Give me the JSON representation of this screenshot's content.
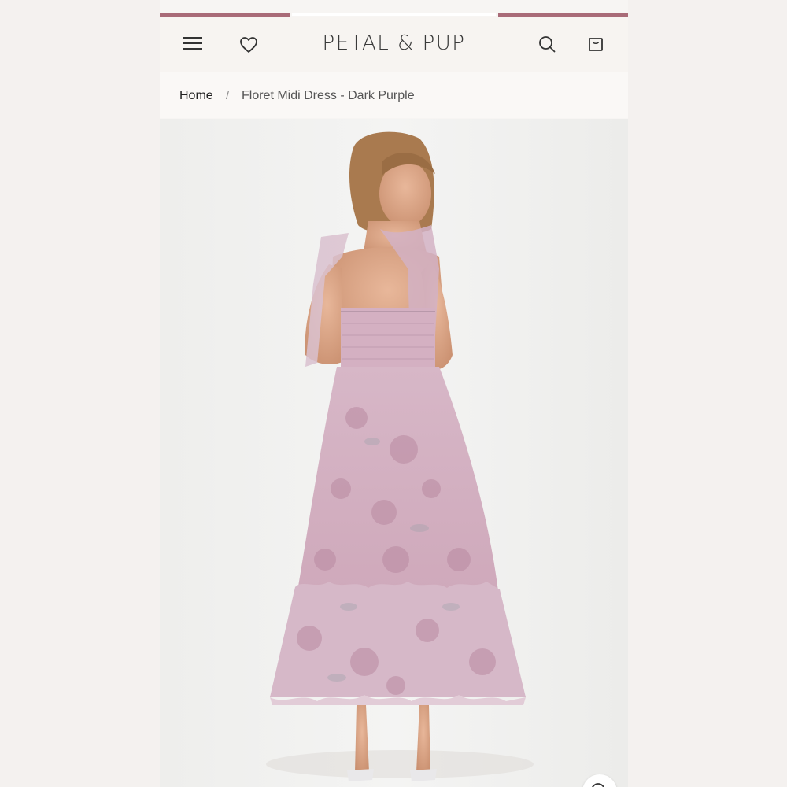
{
  "header": {
    "brand": "PETAL & PUP",
    "icons": {
      "menu": "hamburger-menu-icon",
      "wishlist": "heart-icon",
      "search": "search-icon",
      "cart": "shopping-bag-icon"
    }
  },
  "breadcrumb": {
    "home_label": "Home",
    "separator": "/",
    "current_label": "Floret Midi Dress - Dark Purple"
  },
  "product": {
    "image_alt": "Model wearing floral organza midi dress with tie straps, back view",
    "zoom_icon": "zoom-icon"
  },
  "colors": {
    "accent": "#a96b78",
    "header_bg": "#f7f4f1",
    "dress_pink": "#c99aaa"
  }
}
